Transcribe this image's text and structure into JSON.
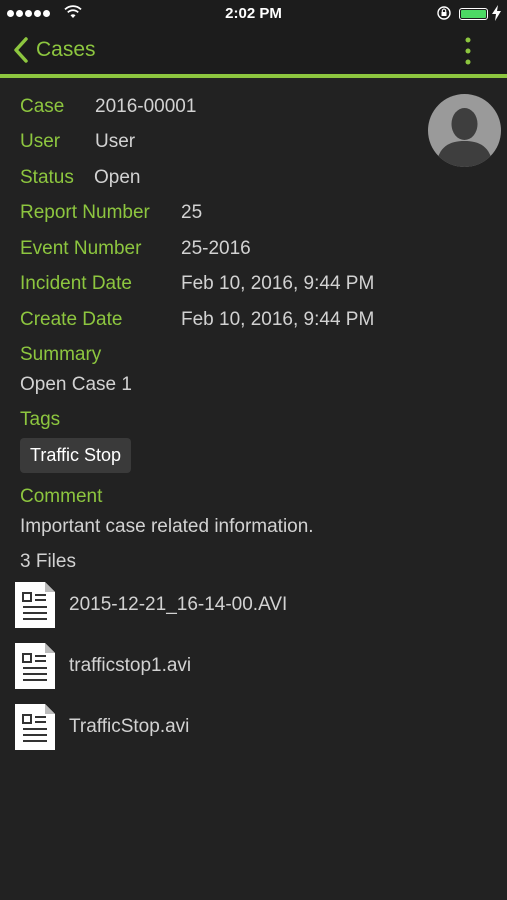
{
  "status_bar": {
    "time": "2:02 PM",
    "battery_color": "#4cd964"
  },
  "nav": {
    "back_label": "Cases",
    "accent_color": "#8dc63f"
  },
  "case": {
    "case_label": "Case",
    "case_value": "2016-00001",
    "user_label": "User",
    "user_value": "User",
    "status_label": "Status",
    "status_value": "Open",
    "report_number_label": "Report Number",
    "report_number_value": "25",
    "event_number_label": "Event Number",
    "event_number_value": "25-2016",
    "incident_date_label": "Incident Date",
    "incident_date_value": "Feb 10, 2016, 9:44 PM",
    "create_date_label": "Create Date",
    "create_date_value": "Feb 10, 2016, 9:44 PM",
    "summary_label": "Summary",
    "summary_value": "Open Case 1",
    "tags_label": "Tags",
    "tags": [
      "Traffic Stop"
    ],
    "comment_label": "Comment",
    "comment_value": "Important case related information."
  },
  "files": {
    "count_label": "3 Files",
    "items": [
      "2015-12-21_16-14-00.AVI",
      "trafficstop1.avi",
      "TrafficStop.avi"
    ]
  },
  "icons": [
    "wifi-icon",
    "rotation-lock-icon",
    "battery-icon",
    "charging-icon",
    "chevron-left-icon",
    "more-vertical-icon",
    "avatar-placeholder-icon",
    "file-icon"
  ]
}
